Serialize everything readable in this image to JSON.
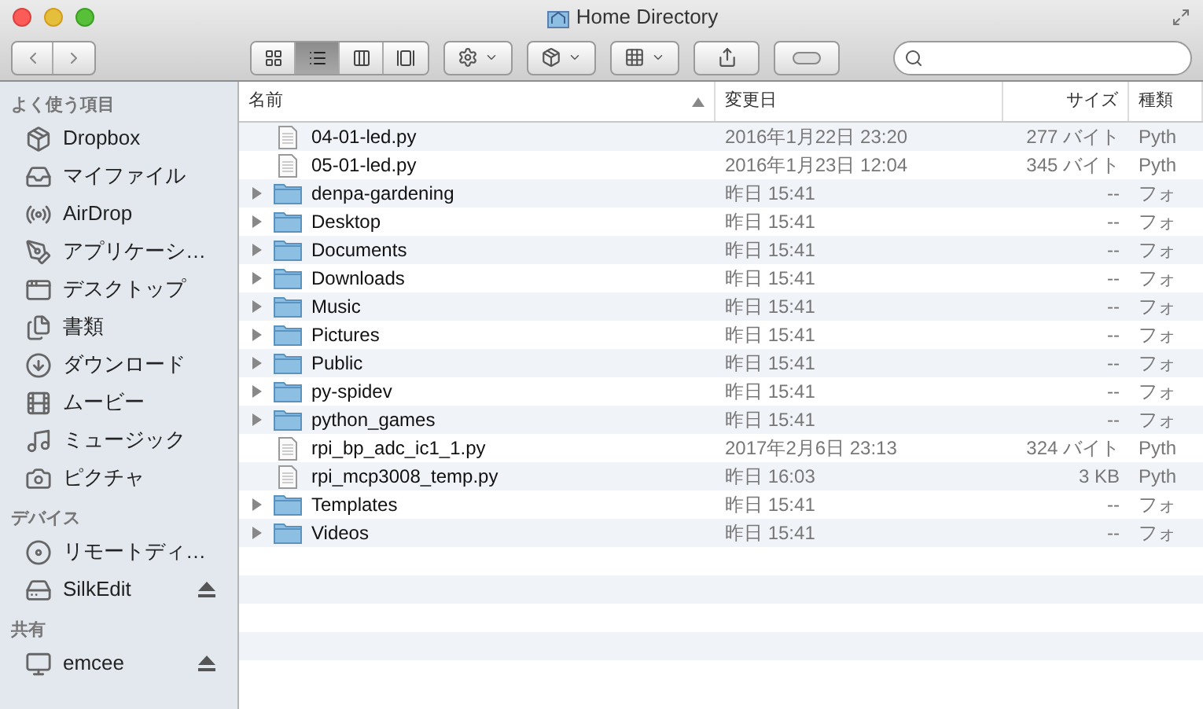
{
  "window": {
    "title": "Home Directory"
  },
  "toolbar": {
    "view_modes": [
      {
        "selected": false
      },
      {
        "selected": true
      },
      {
        "selected": false
      },
      {
        "selected": false
      }
    ]
  },
  "sidebar": {
    "sections": [
      {
        "title": "よく使う項目",
        "items": [
          {
            "label": "Dropbox",
            "eject": false
          },
          {
            "label": "マイファイル",
            "eject": false
          },
          {
            "label": "AirDrop",
            "eject": false
          },
          {
            "label": "アプリケーシ…",
            "eject": false
          },
          {
            "label": "デスクトップ",
            "eject": false
          },
          {
            "label": "書類",
            "eject": false
          },
          {
            "label": "ダウンロード",
            "eject": false
          },
          {
            "label": "ムービー",
            "eject": false
          },
          {
            "label": "ミュージック",
            "eject": false
          },
          {
            "label": "ピクチャ",
            "eject": false
          }
        ]
      },
      {
        "title": "デバイス",
        "items": [
          {
            "label": "リモートディ…",
            "eject": false
          },
          {
            "label": "SilkEdit",
            "eject": true
          }
        ]
      },
      {
        "title": "共有",
        "items": [
          {
            "label": "emcee",
            "eject": true
          }
        ]
      }
    ]
  },
  "table": {
    "columns": [
      {
        "label": "名前",
        "sorted": true
      },
      {
        "label": "変更日",
        "sorted": false
      },
      {
        "label": "サイズ",
        "sorted": false
      },
      {
        "label": "種類",
        "sorted": false
      }
    ],
    "rows": [
      {
        "kind": "file",
        "name": "04-01-led.py",
        "date": "2016年1月22日 23:20",
        "size": "277 バイト",
        "type": "Pyth"
      },
      {
        "kind": "file",
        "name": "05-01-led.py",
        "date": "2016年1月23日 12:04",
        "size": "345 バイト",
        "type": "Pyth"
      },
      {
        "kind": "folder",
        "expanded": false,
        "name": "denpa-gardening",
        "date": "昨日 15:41",
        "size": "--",
        "type": "フォ"
      },
      {
        "kind": "folder",
        "expanded": false,
        "name": "Desktop",
        "date": "昨日 15:41",
        "size": "--",
        "type": "フォ"
      },
      {
        "kind": "folder",
        "expanded": false,
        "name": "Documents",
        "date": "昨日 15:41",
        "size": "--",
        "type": "フォ"
      },
      {
        "kind": "folder",
        "expanded": false,
        "name": "Downloads",
        "date": "昨日 15:41",
        "size": "--",
        "type": "フォ"
      },
      {
        "kind": "folder",
        "expanded": false,
        "name": "Music",
        "date": "昨日 15:41",
        "size": "--",
        "type": "フォ"
      },
      {
        "kind": "folder",
        "expanded": false,
        "name": "Pictures",
        "date": "昨日 15:41",
        "size": "--",
        "type": "フォ"
      },
      {
        "kind": "folder",
        "expanded": false,
        "name": "Public",
        "date": "昨日 15:41",
        "size": "--",
        "type": "フォ"
      },
      {
        "kind": "folder",
        "expanded": false,
        "name": "py-spidev",
        "date": "昨日 15:41",
        "size": "--",
        "type": "フォ"
      },
      {
        "kind": "folder",
        "expanded": false,
        "name": "python_games",
        "date": "昨日 15:41",
        "size": "--",
        "type": "フォ"
      },
      {
        "kind": "file",
        "name": "rpi_bp_adc_ic1_1.py",
        "date": "2017年2月6日 23:13",
        "size": "324 バイト",
        "type": "Pyth"
      },
      {
        "kind": "file",
        "name": "rpi_mcp3008_temp.py",
        "date": "昨日 16:03",
        "size": "3 KB",
        "type": "Pyth"
      },
      {
        "kind": "folder",
        "expanded": false,
        "name": "Templates",
        "date": "昨日 15:41",
        "size": "--",
        "type": "フォ"
      },
      {
        "kind": "folder",
        "expanded": false,
        "name": "Videos",
        "date": "昨日 15:41",
        "size": "--",
        "type": "フォ"
      }
    ]
  }
}
